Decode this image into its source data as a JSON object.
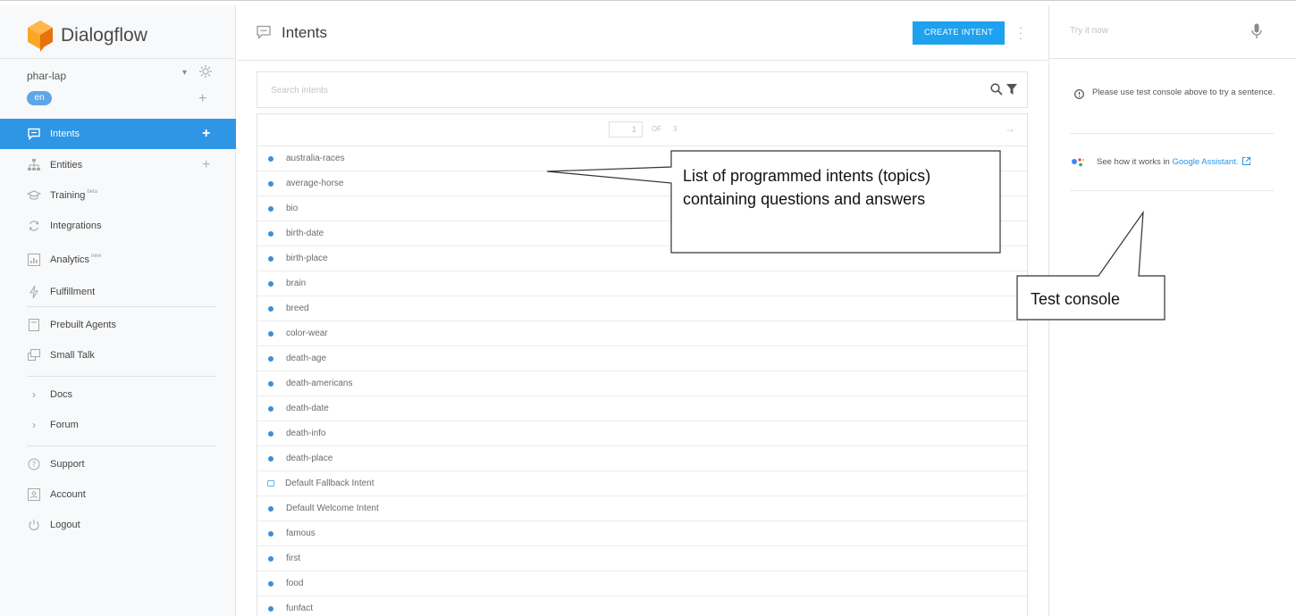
{
  "brand": {
    "name": "Dialogflow",
    "logo_color": "#f5871f"
  },
  "agent": {
    "name": "phar-lap",
    "language": "en"
  },
  "sidebar": {
    "items": [
      {
        "label": "Intents",
        "icon": "chat-bubble-icon",
        "active": true
      },
      {
        "label": "Entities",
        "icon": "hierarchy-icon",
        "active": false
      },
      {
        "label": "Training",
        "badge": "beta",
        "icon": "graduation-cap-icon",
        "active": false
      },
      {
        "label": "Integrations",
        "icon": "refresh-icon",
        "active": false
      },
      {
        "label": "Analytics",
        "badge": "new",
        "icon": "bar-chart-icon",
        "active": false
      },
      {
        "label": "Fulfillment",
        "icon": "lightning-icon",
        "active": false
      },
      {
        "label": "Prebuilt Agents",
        "icon": "document-icon",
        "active": false
      },
      {
        "label": "Small Talk",
        "icon": "chat-stack-icon",
        "active": false
      },
      {
        "label": "Docs",
        "icon": "chevron-right-icon",
        "active": false
      },
      {
        "label": "Forum",
        "icon": "chevron-right-icon",
        "active": false
      },
      {
        "label": "Support",
        "icon": "help-circle-icon",
        "active": false
      },
      {
        "label": "Account",
        "icon": "account-box-icon",
        "active": false
      },
      {
        "label": "Logout",
        "icon": "power-icon",
        "active": false
      }
    ],
    "accent_color": "#2f95e5"
  },
  "header": {
    "title": "Intents",
    "create_button": "CREATE INTENT"
  },
  "search": {
    "placeholder": "Search intents"
  },
  "pager": {
    "current": "1",
    "of_label": "OF",
    "total": "3"
  },
  "intents": [
    "australia-races",
    "average-horse",
    "bio",
    "birth-date",
    "birth-place",
    "brain",
    "breed",
    "color-wear",
    "death-age",
    "death-americans",
    "death-date",
    "death-info",
    "death-place",
    "Default Fallback Intent",
    "Default Welcome Intent",
    "famous",
    "first",
    "food",
    "funfact"
  ],
  "console": {
    "try_placeholder": "Try it now",
    "info_text": "Please use test console above to try a sentence.",
    "ga_text": "See how it works in",
    "ga_link": "Google Assistant."
  },
  "annotations": {
    "intents_callout": "List of programmed intents (topics) containing questions and answers",
    "console_callout": "Test console"
  }
}
